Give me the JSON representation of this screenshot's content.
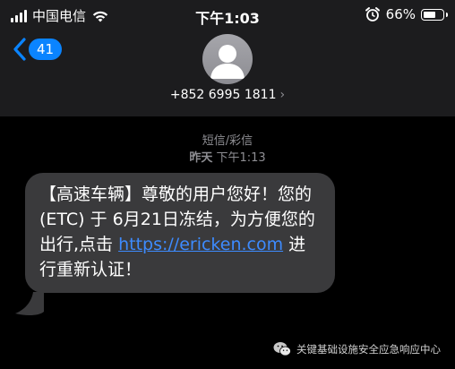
{
  "status_bar": {
    "carrier": "中国电信",
    "time": "下午1:03",
    "battery_percent": "66%",
    "battery_level": 0.66,
    "icons": [
      "signal-icon",
      "wifi-icon",
      "alarm-icon",
      "battery-icon"
    ]
  },
  "nav": {
    "back_badge": "41",
    "contact_number": "+852 6995 1811",
    "contact_chevron": "›",
    "avatar_icon": "person-silhouette-icon"
  },
  "conversation": {
    "message_type": "短信/彩信",
    "timestamp_day": "昨天",
    "timestamp_time": "下午1:13"
  },
  "message": {
    "text_before_link": "【高速车辆】尊敬的用户您好！您的 (ETC) 于 6月21日冻结，为方便您的出行,点击 ",
    "link": "https://ericken.com",
    "text_after_link": " 进行重新认证！"
  },
  "watermark": {
    "text": "关键基础设施安全应急响应中心",
    "icon": "wechat-icon"
  },
  "colors": {
    "header_bg": "#1c1c1e",
    "accent_blue": "#0a84ff",
    "bubble_bg": "#3a3a3c",
    "link_blue": "#3d8bff",
    "meta_gray": "#8e8e93"
  }
}
